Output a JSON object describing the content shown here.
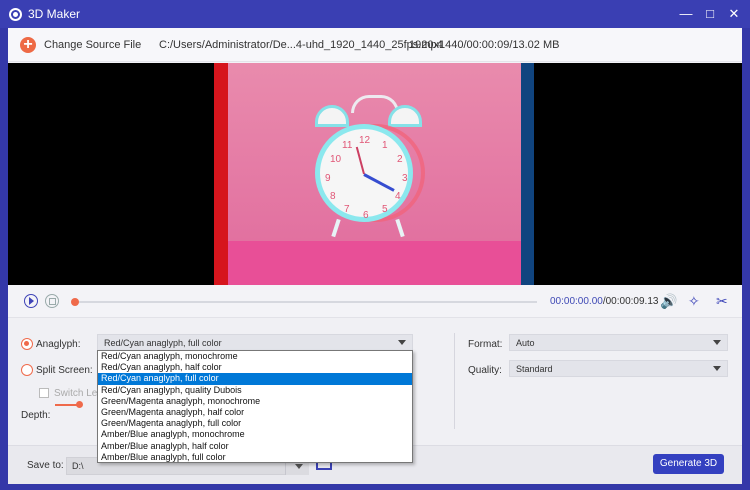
{
  "window": {
    "title": "3D Maker"
  },
  "toolbar": {
    "change_source_label": "Change Source File",
    "file_path": "C:/Users/Administrator/De...4-uhd_1920_1440_25fps.mp4",
    "file_info": "1920x1440/00:00:09/13.02 MB"
  },
  "playback": {
    "current_time": "00:00:00.00",
    "separator": "/",
    "total_time": "00:00:09.13",
    "progress": 0
  },
  "settings": {
    "anaglyph_label": "Anaglyph:",
    "split_screen_label": "Split Screen:",
    "switch_left_right_label": "Switch Left",
    "depth_label": "Depth:",
    "anaglyph_value": "Red/Cyan anaglyph, full color",
    "format_label": "Format:",
    "format_value": "Auto",
    "quality_label": "Quality:",
    "quality_value": "Standard"
  },
  "bottom": {
    "save_to_label": "Save to:",
    "path": "D:\\",
    "generate_label": "Generate 3D"
  },
  "dropdown": {
    "options": [
      "Red/Cyan anaglyph, monochrome",
      "Red/Cyan anaglyph, half color",
      "Red/Cyan anaglyph, full color",
      "Red/Cyan anaglyph, quality Dubois",
      "Green/Magenta anaglyph, monochrome",
      "Green/Magenta anaglyph, half color",
      "Green/Magenta anaglyph, full color",
      "Amber/Blue anaglyph, monochrome",
      "Amber/Blue anaglyph, half color",
      "Amber/Blue anaglyph, full color"
    ],
    "selected_index": 2
  },
  "clock": {
    "numbers": [
      "12",
      "1",
      "2",
      "3",
      "4",
      "5",
      "6",
      "7",
      "8",
      "9",
      "10",
      "11"
    ]
  }
}
